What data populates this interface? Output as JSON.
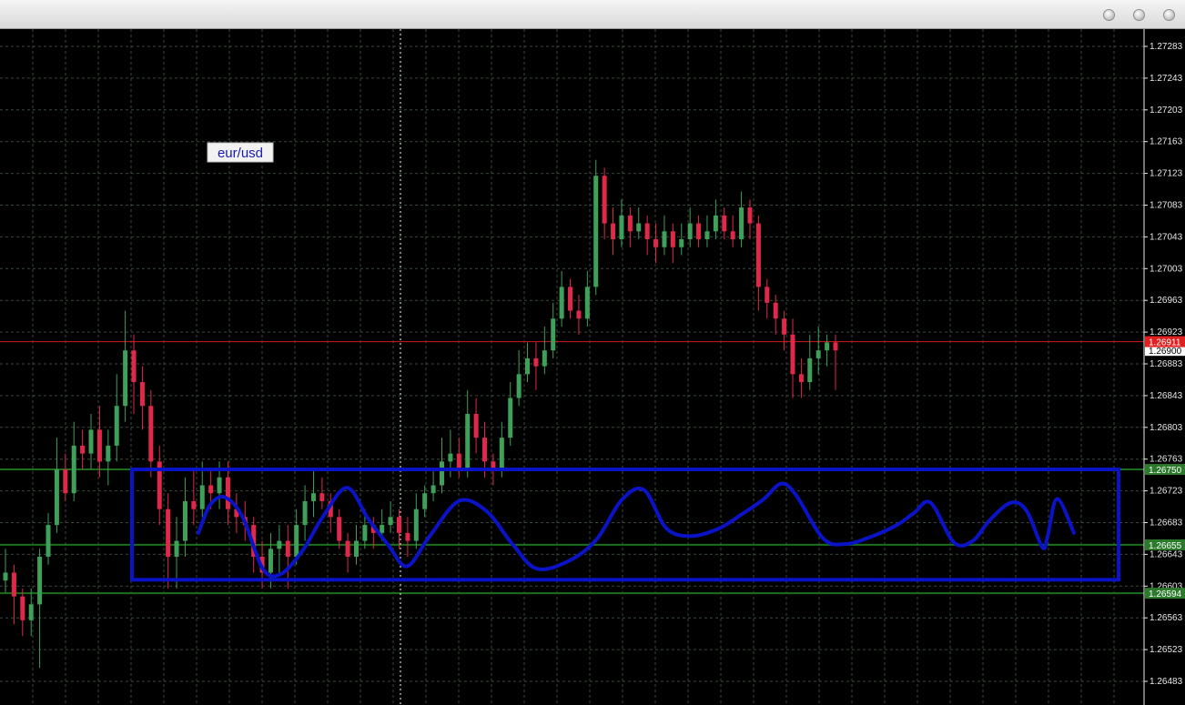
{
  "window": {
    "buttons": [
      "minimize-button",
      "maximize-button",
      "close-button"
    ]
  },
  "colors": {
    "background": "#000000",
    "grid": "#3a4a3a",
    "bull": "#3fa05a",
    "bear": "#e0294a",
    "axis_text": "#e8e8e8",
    "blue_drawing": "#0b13c8",
    "red_line": "#d81a1a",
    "green_line": "#1c6f1c",
    "bid_label_bg": "#e02020",
    "label_bg": "#ffffff",
    "green_label_bg": "#2c7a2c"
  },
  "chart_data": {
    "type": "candlestick",
    "symbol_label": "eur/usd",
    "ylim": [
      1.26453,
      1.27313
    ],
    "y_ticks": [
      "1.27283",
      "1.27243",
      "1.27203",
      "1.27163",
      "1.27123",
      "1.27083",
      "1.27043",
      "1.27003",
      "1.26963",
      "1.26923",
      "1.26883",
      "1.26843",
      "1.26803",
      "1.26763",
      "1.26723",
      "1.26683",
      "1.26643",
      "1.26603",
      "1.26563",
      "1.26523",
      "1.26483"
    ],
    "price_labels": [
      {
        "text": "1.26900",
        "price": 1.269,
        "style": "white"
      },
      {
        "text": "1.26911",
        "price": 1.26911,
        "style": "red"
      },
      {
        "text": "1.26750",
        "price": 1.2675,
        "style": "green"
      },
      {
        "text": "1.26655",
        "price": 1.26655,
        "style": "green"
      },
      {
        "text": "1.26594",
        "price": 1.26594,
        "style": "green"
      }
    ],
    "horizontal_lines": [
      {
        "name": "bid-line",
        "price": 1.26911,
        "color": "red"
      },
      {
        "name": "range-top-line",
        "price": 1.2675,
        "color": "green"
      },
      {
        "name": "range-mid-line",
        "price": 1.26655,
        "color": "green"
      },
      {
        "name": "range-bottom-line",
        "price": 1.26594,
        "color": "green"
      }
    ],
    "range_box": {
      "price_top": 1.2675,
      "price_bottom": 1.26611
    },
    "wave_points": [
      [
        0.074,
        1.2667
      ],
      [
        0.085,
        1.26705
      ],
      [
        0.099,
        1.26715
      ],
      [
        0.116,
        1.2669
      ],
      [
        0.135,
        1.26625
      ],
      [
        0.152,
        1.26618
      ],
      [
        0.173,
        1.26648
      ],
      [
        0.192,
        1.2669
      ],
      [
        0.215,
        1.26727
      ],
      [
        0.235,
        1.26688
      ],
      [
        0.254,
        1.26655
      ],
      [
        0.272,
        1.26628
      ],
      [
        0.293,
        1.26665
      ],
      [
        0.321,
        1.2671
      ],
      [
        0.347,
        1.26698
      ],
      [
        0.372,
        1.26656
      ],
      [
        0.395,
        1.26625
      ],
      [
        0.426,
        1.26635
      ],
      [
        0.452,
        1.26662
      ],
      [
        0.476,
        1.26712
      ],
      [
        0.497,
        1.26724
      ],
      [
        0.518,
        1.26676
      ],
      [
        0.541,
        1.26666
      ],
      [
        0.567,
        1.26675
      ],
      [
        0.588,
        1.26692
      ],
      [
        0.61,
        1.26712
      ],
      [
        0.627,
        1.26732
      ],
      [
        0.641,
        1.26718
      ],
      [
        0.667,
        1.26663
      ],
      [
        0.688,
        1.26656
      ],
      [
        0.712,
        1.26665
      ],
      [
        0.737,
        1.2668
      ],
      [
        0.753,
        1.26695
      ],
      [
        0.769,
        1.26708
      ],
      [
        0.791,
        1.26658
      ],
      [
        0.809,
        1.2666
      ],
      [
        0.825,
        1.26686
      ],
      [
        0.845,
        1.26708
      ],
      [
        0.86,
        1.26698
      ],
      [
        0.875,
        1.26652
      ],
      [
        0.88,
        1.26666
      ],
      [
        0.889,
        1.26713
      ],
      [
        0.905,
        1.2667
      ]
    ],
    "candles": [
      [
        1.2661,
        1.2662,
        1.2665,
        1.26595
      ],
      [
        1.2662,
        1.2659,
        1.2663,
        1.26555
      ],
      [
        1.2659,
        1.2656,
        1.266,
        1.2654
      ],
      [
        1.2656,
        1.2658,
        1.266,
        1.2654
      ],
      [
        1.2658,
        1.2664,
        1.2665,
        1.265
      ],
      [
        1.2664,
        1.2668,
        1.26695,
        1.2663
      ],
      [
        1.2668,
        1.2675,
        1.2679,
        1.2667
      ],
      [
        1.2675,
        1.2672,
        1.2677,
        1.2671
      ],
      [
        1.2672,
        1.2678,
        1.2681,
        1.2671
      ],
      [
        1.2678,
        1.2677,
        1.268,
        1.2675
      ],
      [
        1.2677,
        1.268,
        1.2682,
        1.2675
      ],
      [
        1.268,
        1.2676,
        1.2683,
        1.2674
      ],
      [
        1.2676,
        1.2678,
        1.268,
        1.2673
      ],
      [
        1.2678,
        1.2683,
        1.2687,
        1.2676
      ],
      [
        1.2683,
        1.269,
        1.2695,
        1.2681
      ],
      [
        1.269,
        1.2686,
        1.2692,
        1.2682
      ],
      [
        1.2686,
        1.2683,
        1.2688,
        1.268
      ],
      [
        1.2683,
        1.2676,
        1.2685,
        1.2674
      ],
      [
        1.2676,
        1.267,
        1.2678,
        1.2668
      ],
      [
        1.267,
        1.2664,
        1.2672,
        1.266
      ],
      [
        1.2664,
        1.2666,
        1.2669,
        1.266
      ],
      [
        1.2666,
        1.2671,
        1.2674,
        1.2664
      ],
      [
        1.2671,
        1.267,
        1.2675,
        1.2668
      ],
      [
        1.267,
        1.2673,
        1.2676,
        1.2669
      ],
      [
        1.2673,
        1.2672,
        1.2675,
        1.267
      ],
      [
        1.2672,
        1.2674,
        1.2676,
        1.267
      ],
      [
        1.2674,
        1.267,
        1.2676,
        1.2668
      ],
      [
        1.267,
        1.2669,
        1.2672,
        1.2667
      ],
      [
        1.2669,
        1.2668,
        1.2671,
        1.2666
      ],
      [
        1.2668,
        1.2664,
        1.2669,
        1.2662
      ],
      [
        1.2664,
        1.2662,
        1.2666,
        1.266
      ],
      [
        1.2662,
        1.2665,
        1.2667,
        1.266
      ],
      [
        1.2665,
        1.2666,
        1.2668,
        1.2662
      ],
      [
        1.2666,
        1.2664,
        1.2668,
        1.266
      ],
      [
        1.2664,
        1.2668,
        1.267,
        1.2663
      ],
      [
        1.2668,
        1.2671,
        1.2673,
        1.2666
      ],
      [
        1.2671,
        1.2672,
        1.2675,
        1.2669
      ],
      [
        1.2672,
        1.2671,
        1.2674,
        1.267
      ],
      [
        1.2671,
        1.2669,
        1.2672,
        1.2667
      ],
      [
        1.2669,
        1.2666,
        1.267,
        1.2665
      ],
      [
        1.2666,
        1.2664,
        1.2667,
        1.2662
      ],
      [
        1.2664,
        1.2666,
        1.2668,
        1.2663
      ],
      [
        1.2666,
        1.2668,
        1.267,
        1.2665
      ],
      [
        1.2668,
        1.2667,
        1.2669,
        1.2665
      ],
      [
        1.2667,
        1.2668,
        1.267,
        1.2666
      ],
      [
        1.2668,
        1.2669,
        1.2671,
        1.2667
      ],
      [
        1.2669,
        1.2667,
        1.267,
        1.2665
      ],
      [
        1.2667,
        1.2666,
        1.2669,
        1.2664
      ],
      [
        1.2666,
        1.267,
        1.2672,
        1.2665
      ],
      [
        1.267,
        1.2672,
        1.2673,
        1.2669
      ],
      [
        1.2672,
        1.2673,
        1.2675,
        1.2671
      ],
      [
        1.2673,
        1.2676,
        1.2679,
        1.2672
      ],
      [
        1.2676,
        1.2677,
        1.268,
        1.2674
      ],
      [
        1.2677,
        1.2675,
        1.2679,
        1.2674
      ],
      [
        1.2675,
        1.2682,
        1.2685,
        1.2674
      ],
      [
        1.2682,
        1.2679,
        1.2684,
        1.2677
      ],
      [
        1.2679,
        1.2676,
        1.2681,
        1.2674
      ],
      [
        1.2676,
        1.2675,
        1.2677,
        1.2673
      ],
      [
        1.2675,
        1.2679,
        1.2681,
        1.2674
      ],
      [
        1.2679,
        1.2684,
        1.2686,
        1.2678
      ],
      [
        1.2684,
        1.2687,
        1.269,
        1.2683
      ],
      [
        1.2687,
        1.2689,
        1.2691,
        1.2686
      ],
      [
        1.2689,
        1.2688,
        1.2691,
        1.2685
      ],
      [
        1.2688,
        1.269,
        1.2693,
        1.2687
      ],
      [
        1.269,
        1.2694,
        1.2696,
        1.2689
      ],
      [
        1.2694,
        1.2698,
        1.27,
        1.2693
      ],
      [
        1.2698,
        1.2695,
        1.2699,
        1.2694
      ],
      [
        1.2695,
        1.2694,
        1.2697,
        1.2692
      ],
      [
        1.2694,
        1.2698,
        1.27,
        1.2693
      ],
      [
        1.2698,
        1.2712,
        1.2714,
        1.2697
      ],
      [
        1.2712,
        1.2706,
        1.2713,
        1.2704
      ],
      [
        1.2706,
        1.2704,
        1.2708,
        1.2702
      ],
      [
        1.2704,
        1.2707,
        1.2709,
        1.2703
      ],
      [
        1.2707,
        1.2705,
        1.2708,
        1.2703
      ],
      [
        1.2705,
        1.2706,
        1.2708,
        1.2704
      ],
      [
        1.2706,
        1.2704,
        1.2707,
        1.2702
      ],
      [
        1.2704,
        1.2703,
        1.2706,
        1.2701
      ],
      [
        1.2703,
        1.2705,
        1.2707,
        1.2702
      ],
      [
        1.2705,
        1.2703,
        1.2706,
        1.2701
      ],
      [
        1.2703,
        1.2704,
        1.2706,
        1.2702
      ],
      [
        1.2704,
        1.2706,
        1.2708,
        1.2703
      ],
      [
        1.2706,
        1.2704,
        1.2707,
        1.2703
      ],
      [
        1.2704,
        1.2705,
        1.2707,
        1.2703
      ],
      [
        1.2705,
        1.2707,
        1.2709,
        1.2704
      ],
      [
        1.2707,
        1.2705,
        1.2708,
        1.2704
      ],
      [
        1.2705,
        1.2704,
        1.2707,
        1.2703
      ],
      [
        1.2704,
        1.2708,
        1.271,
        1.2703
      ],
      [
        1.2708,
        1.2706,
        1.2709,
        1.2704
      ],
      [
        1.2706,
        1.2698,
        1.2707,
        1.2695
      ],
      [
        1.2698,
        1.2696,
        1.2699,
        1.2694
      ],
      [
        1.2696,
        1.2694,
        1.2697,
        1.2692
      ],
      [
        1.2694,
        1.2692,
        1.2695,
        1.269
      ],
      [
        1.2692,
        1.2687,
        1.2694,
        1.2684
      ],
      [
        1.2687,
        1.2686,
        1.2689,
        1.2684
      ],
      [
        1.2686,
        1.2689,
        1.2692,
        1.2685
      ],
      [
        1.2689,
        1.269,
        1.2693,
        1.2687
      ],
      [
        1.269,
        1.2691,
        1.2692,
        1.2688
      ],
      [
        1.2691,
        1.269,
        1.2692,
        1.2685
      ]
    ]
  }
}
